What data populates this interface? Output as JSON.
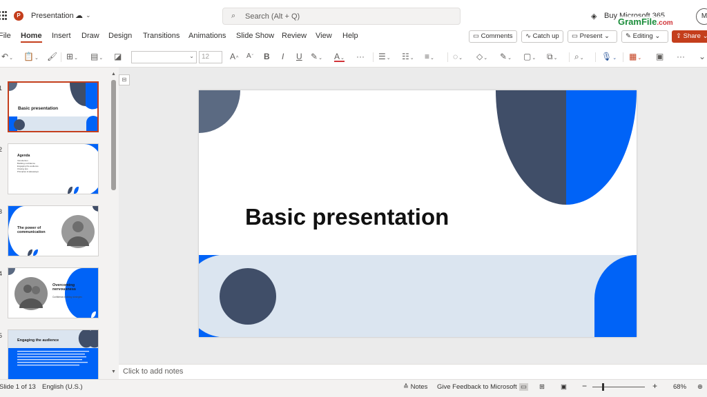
{
  "app": {
    "title": "Presentation",
    "logo_letter": "P",
    "search_placeholder": "Search (Alt + Q)",
    "buy_text": "Buy Microsoft 365",
    "watermark": "GramFile",
    "watermark_suffix": ".com",
    "user_initial": "M"
  },
  "menu": {
    "tabs": [
      "File",
      "Home",
      "Insert",
      "Draw",
      "Design",
      "Transitions",
      "Animations",
      "Slide Show",
      "Review",
      "View",
      "Help"
    ],
    "active_tab": "Home",
    "comments": "Comments",
    "catch_up": "Catch up",
    "present": "Present",
    "editing": "Editing",
    "share": "Share"
  },
  "toolbar": {
    "font_size": "12",
    "grow": "A",
    "shrink": "A",
    "bold": "B",
    "italic": "I",
    "underline": "U",
    "strike": "ab",
    "font_color": "A",
    "more": "···"
  },
  "slides": [
    {
      "number": "1",
      "title": "Basic presentation",
      "selected": true
    },
    {
      "number": "2",
      "title": "Agenda",
      "lines": [
        "Introduction",
        "Building confidence",
        "Engaging the audience",
        "Closing tips",
        "Principles & takeaways"
      ]
    },
    {
      "number": "3",
      "title": "The power of communication"
    },
    {
      "number": "4",
      "title": "Overcoming nervousness",
      "subtitle": "Confidence-building strategies"
    },
    {
      "number": "5",
      "title": "Engaging the audience"
    }
  ],
  "main_slide": {
    "title": "Basic presentation"
  },
  "notes": {
    "placeholder": "Click to add notes"
  },
  "status": {
    "slide_counter": "Slide 1 of 13",
    "language": "English (U.S.)",
    "notes": "Notes",
    "feedback": "Give Feedback to Microsoft",
    "zoom_minus": "−",
    "zoom_plus": "+",
    "zoom": "68%"
  },
  "colors": {
    "accent": "#c43e1c",
    "slide_blue": "#0063f7",
    "slide_navy": "#404e68",
    "slide_slate": "#5b6a82",
    "slide_pale": "#dbe5f0"
  }
}
